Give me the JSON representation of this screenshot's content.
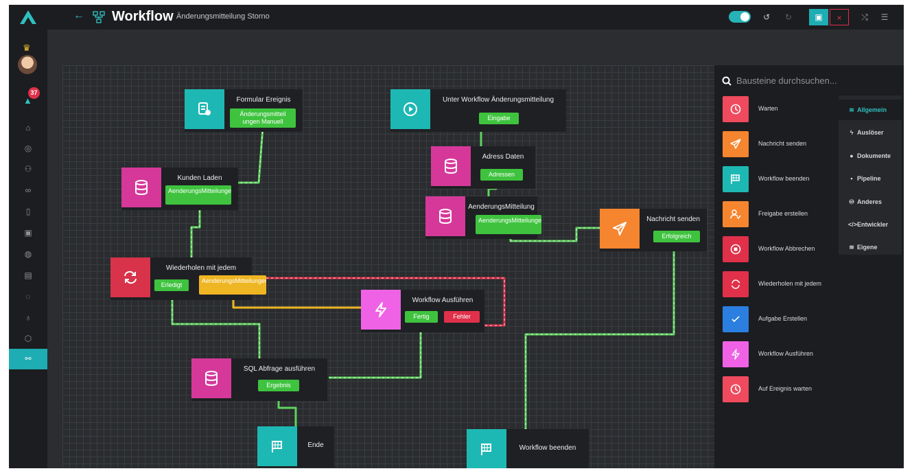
{
  "header": {
    "title": "Workflow",
    "subtitle": "Änderungsmitteilung Storno",
    "back_icon": "arrow-left-icon",
    "active_toggle_on": true,
    "buttons": [
      "undo-icon",
      "redo-icon",
      "save-icon",
      "close-icon",
      "shuffle-icon",
      "sliders-icon"
    ]
  },
  "sidebar": {
    "notification_count": "37",
    "items": [
      "home-icon",
      "dashboard-icon",
      "users-icon",
      "link-icon",
      "trash-icon",
      "camera-icon",
      "globe-icon",
      "calendar-icon",
      "refresh-icon",
      "lightbulb-icon",
      "shield-icon",
      "workflow-icon"
    ],
    "active_item": "workflow-icon"
  },
  "canvas": {
    "nodes": {
      "formular": {
        "title": "Formular Ereignis",
        "port": "Änderungsmitteil ungen Manuell",
        "icon": "form-icon"
      },
      "kunden": {
        "title": "Kunden Laden",
        "port": "AenderungsMitteilungen_Kunden",
        "icon": "database-icon"
      },
      "wiederholen": {
        "title": "Wiederholen mit jedem",
        "port_done": "Erledigt",
        "port_item": "AenderungsMitteilungen_Kunden",
        "icon": "repeat-icon"
      },
      "ausfuehren": {
        "title": "Workflow Ausführen",
        "port_ok": "Fertig",
        "port_err": "Fehler",
        "icon": "bolt-icon"
      },
      "sql": {
        "title": "SQL Abfrage ausführen",
        "port": "Ergebnis",
        "icon": "database-icon"
      },
      "ende": {
        "title": "Ende",
        "icon": "flag-icon"
      },
      "unter": {
        "title": "Unter Workflow Änderungsmitteilung",
        "port": "Eingabe",
        "icon": "play-icon"
      },
      "adress": {
        "title": "Adress Daten",
        "port": "Adressen",
        "icon": "database-icon"
      },
      "aenderung": {
        "title": "AenderungsMitteilung",
        "port": "AenderungsMitteilungen",
        "icon": "database-icon"
      },
      "nachricht": {
        "title": "Nachricht senden",
        "port": "Erfolgreich",
        "icon": "send-icon"
      },
      "beenden": {
        "title": "Workflow beenden",
        "icon": "flag-icon"
      }
    }
  },
  "panel": {
    "search_placeholder": "Bausteine durchsuchen...",
    "blocks": [
      {
        "label": "Warten",
        "color": "#f04a5e",
        "icon": "clock-icon"
      },
      {
        "label": "Nachricht senden",
        "color": "#f5852e",
        "icon": "send-icon"
      },
      {
        "label": "Workflow beenden",
        "color": "#1eb8b4",
        "icon": "flag-icon"
      },
      {
        "label": "Freigabe erstellen",
        "color": "#f5852e",
        "icon": "user-check-icon"
      },
      {
        "label": "Workflow Abbrechen",
        "color": "#e0304a",
        "icon": "stop-icon"
      },
      {
        "label": "Wiederholen mit jedem",
        "color": "#e0304a",
        "icon": "repeat-icon"
      },
      {
        "label": "Aufgabe Erstellen",
        "color": "#2a7fe0",
        "icon": "check-icon"
      },
      {
        "label": "Workflow Ausführen",
        "color": "#ef62e6",
        "icon": "bolt-icon"
      },
      {
        "label": "Auf Ereignis warten",
        "color": "#f04a5e",
        "icon": "clock-icon"
      }
    ],
    "categories": [
      {
        "label": "Allgemein",
        "active": true,
        "icon": "stack-icon"
      },
      {
        "label": "Auslöser",
        "active": false,
        "icon": "bolt-icon"
      },
      {
        "label": "Dokumente",
        "active": false,
        "icon": "document-icon"
      },
      {
        "label": "Pipeline",
        "active": false,
        "icon": "pipeline-icon"
      },
      {
        "label": "Anderes",
        "active": false,
        "icon": "misc-icon"
      },
      {
        "label": "Entwickler",
        "active": false,
        "icon": "code-icon"
      },
      {
        "label": "Eigene",
        "active": false,
        "icon": "stack-icon"
      }
    ]
  }
}
